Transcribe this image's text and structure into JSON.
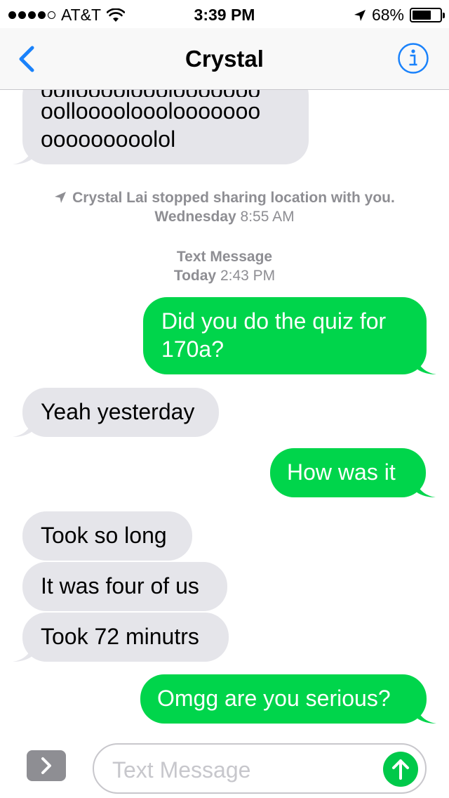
{
  "status_bar": {
    "carrier": "AT&T",
    "time": "3:39 PM",
    "battery": "68%",
    "battery_level": 0.68,
    "signal_bars_filled": 4,
    "signal_bars_total": 5
  },
  "nav": {
    "title": "Crystal",
    "back_icon": "chevron-left-icon",
    "info_icon": "info-icon"
  },
  "messages": [
    {
      "direction": "in",
      "lines": [
        "oolloooolooolooooooo",
        "ooooooooolol"
      ]
    },
    {
      "direction": "out",
      "lines": [
        "Did you do the quiz for",
        "170a?"
      ]
    },
    {
      "direction": "in",
      "lines": [
        "Yeah yesterday"
      ]
    },
    {
      "direction": "out",
      "lines": [
        "How was it"
      ]
    },
    {
      "direction": "in",
      "lines": [
        "Took so long"
      ]
    },
    {
      "direction": "in",
      "lines": [
        "It was four of us"
      ]
    },
    {
      "direction": "in",
      "lines": [
        "Took 72 minutrs"
      ]
    },
    {
      "direction": "out",
      "lines": [
        "Omgg are you serious?"
      ]
    }
  ],
  "notices": {
    "location": {
      "text": "Crystal Lai stopped sharing location with you.",
      "day": "Wednesday",
      "time": "8:55 AM"
    },
    "service": {
      "label": "Text Message",
      "day": "Today",
      "time": "2:43 PM"
    }
  },
  "input": {
    "placeholder": "Text Message"
  },
  "colors": {
    "outgoing_bubble": "#00d54b",
    "incoming_bubble": "#e5e5ea",
    "accent": "#1a82fb",
    "meta_text": "#8e8e93"
  }
}
